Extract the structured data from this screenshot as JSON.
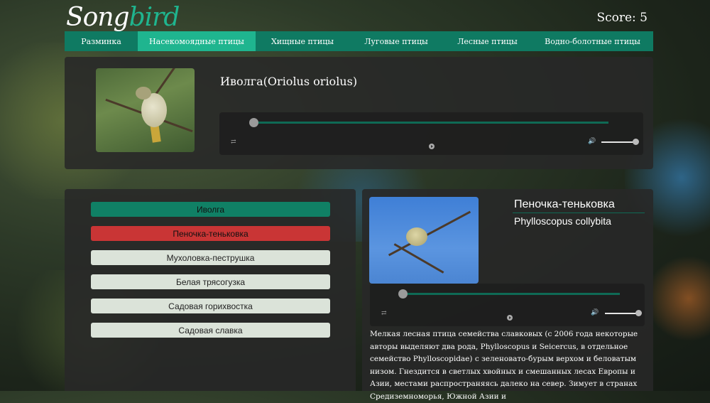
{
  "header": {
    "logo_part1": "Song",
    "logo_part2": "bird",
    "score_label": "Score: 5"
  },
  "nav": {
    "items": [
      {
        "label": "Разминка",
        "active": false
      },
      {
        "label": "Насекомоядные птицы",
        "active": true
      },
      {
        "label": "Хищные птицы",
        "active": false
      },
      {
        "label": "Луговые птицы",
        "active": false
      },
      {
        "label": "Лесные птицы",
        "active": false
      },
      {
        "label": "Водно-болотные птицы",
        "active": false
      }
    ]
  },
  "question": {
    "title": "Иволга(Oriolus oriolus)",
    "image_icon": "bird-photo-oriole"
  },
  "answers": [
    {
      "label": "Иволга",
      "state": "correct"
    },
    {
      "label": "Пеночка-теньковка",
      "state": "wrong"
    },
    {
      "label": "Мухоловка-пеструшка",
      "state": "default"
    },
    {
      "label": "Белая трясогузка",
      "state": "default"
    },
    {
      "label": "Садовая горихвостка",
      "state": "default"
    },
    {
      "label": "Садовая славка",
      "state": "default"
    }
  ],
  "details": {
    "name_ru": "Пеночка-теньковка",
    "name_lat": "Phylloscopus collybita",
    "description": "Мелкая лесная птица семейства славковых (с 2006 года некоторые авторы выделяют два рода, Phylloscopus и Seicercus, в отдельное семейство Phylloscopidae) с зеленовато-бурым верхом и беловатым низом. Гнездится в светлых хвойных и смешанных лесах Европы и Азии, местами распространяясь далеко на север. Зимует в странах Средиземноморья, Южной Азии и"
  },
  "colors": {
    "accent": "#1fb58f",
    "nav_bg": "#0f7a62",
    "correct": "#108065",
    "wrong": "#c93535",
    "default_answer": "#dbe3d9"
  }
}
